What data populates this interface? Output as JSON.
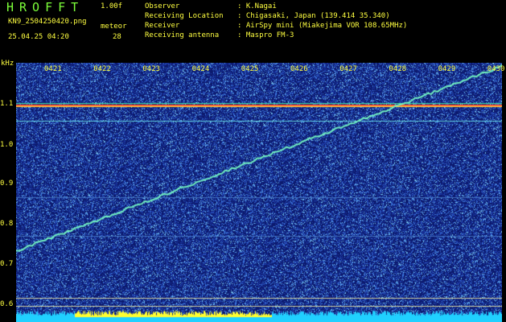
{
  "header": {
    "app_title": "HROFFT",
    "version": "1.00f",
    "filename": "KN9_2504250420.png",
    "datetime": "25.04.25 04:20",
    "station_label": "meteor",
    "count": "28"
  },
  "meta": [
    {
      "key": "Observer",
      "value": ": K.Nagai"
    },
    {
      "key": "Receiving Location",
      "value": ": Chigasaki, Japan (139.414 35.340)"
    },
    {
      "key": "Receiver",
      "value": ": AirSpy mini (Miakejima VOR 108.65MHz)"
    },
    {
      "key": "Receiving antenna",
      "value": ": Maspro FM-3"
    }
  ],
  "axis": {
    "y_unit": "kHz",
    "y_ticks": [
      "1.1",
      "1.0",
      "0.9",
      "0.8",
      "0.7",
      "0.6"
    ],
    "x_ticks": [
      "0421",
      "0422",
      "0423",
      "0424",
      "0425",
      "0426",
      "0427",
      "0428",
      "0429",
      "0430"
    ]
  },
  "colors": {
    "text": "#ffff40",
    "title": "#7dff3a",
    "background": "#0a1a6a",
    "trace": "#6cf0c8",
    "carrier": "#ff5030",
    "baseline": "#20d0ff"
  }
}
